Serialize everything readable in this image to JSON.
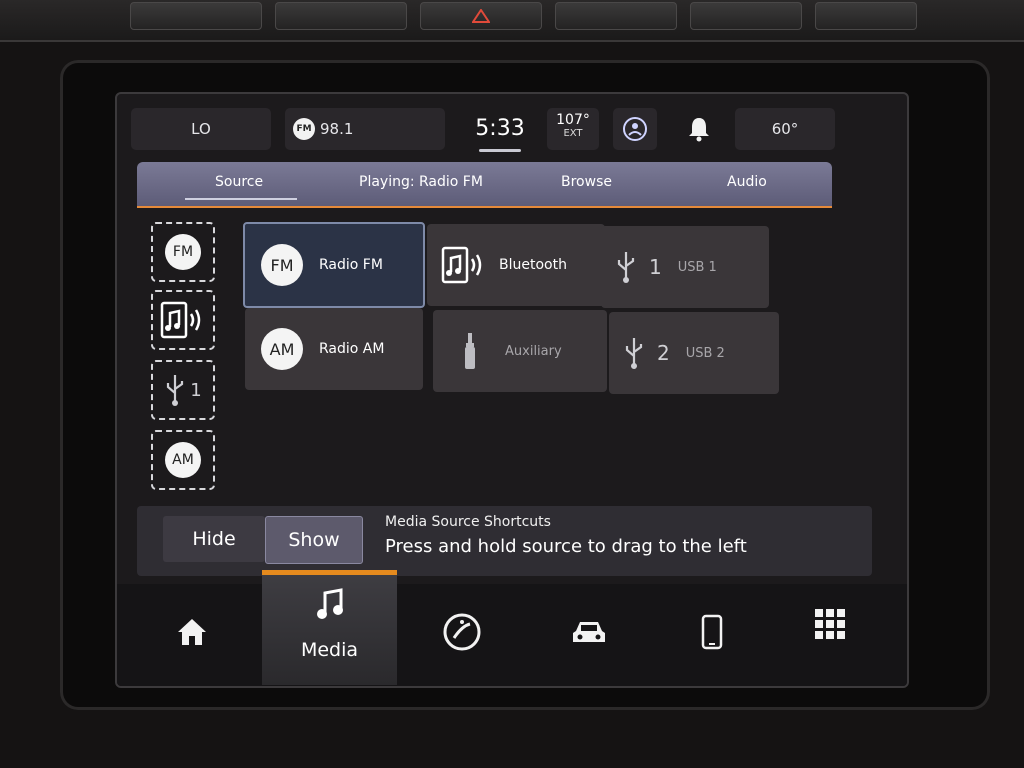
{
  "status": {
    "fan_level": "LO",
    "radio_band": "FM",
    "radio_freq": "98.1",
    "clock": "5:33",
    "ext_temp": "107°",
    "ext_label": "EXT",
    "set_temp": "60°"
  },
  "tabs": [
    {
      "label": "Source"
    },
    {
      "label": "Playing: Radio FM"
    },
    {
      "label": "Browse"
    },
    {
      "label": "Audio"
    }
  ],
  "shortcuts": [
    {
      "text": "FM"
    },
    {
      "text": ""
    },
    {
      "text": "1"
    },
    {
      "text": "AM"
    }
  ],
  "sources": {
    "radio_fm": {
      "badge": "FM",
      "label": "Radio FM"
    },
    "bluetooth": {
      "label": "Bluetooth"
    },
    "usb1": {
      "num": "1",
      "label": "USB 1"
    },
    "radio_am": {
      "badge": "AM",
      "label": "Radio AM"
    },
    "auxiliary": {
      "label": "Auxiliary"
    },
    "usb2": {
      "num": "2",
      "label": "USB 2"
    }
  },
  "shortcuts_bar": {
    "hide_label": "Hide",
    "show_label": "Show",
    "title": "Media Source Shortcuts",
    "message": "Press and hold source to drag to the left"
  },
  "nav": {
    "media_label": "Media"
  },
  "colors": {
    "accent": "#e58a1e",
    "tab_bar": "#6c6b88",
    "selected_tile": "#2b3346"
  }
}
